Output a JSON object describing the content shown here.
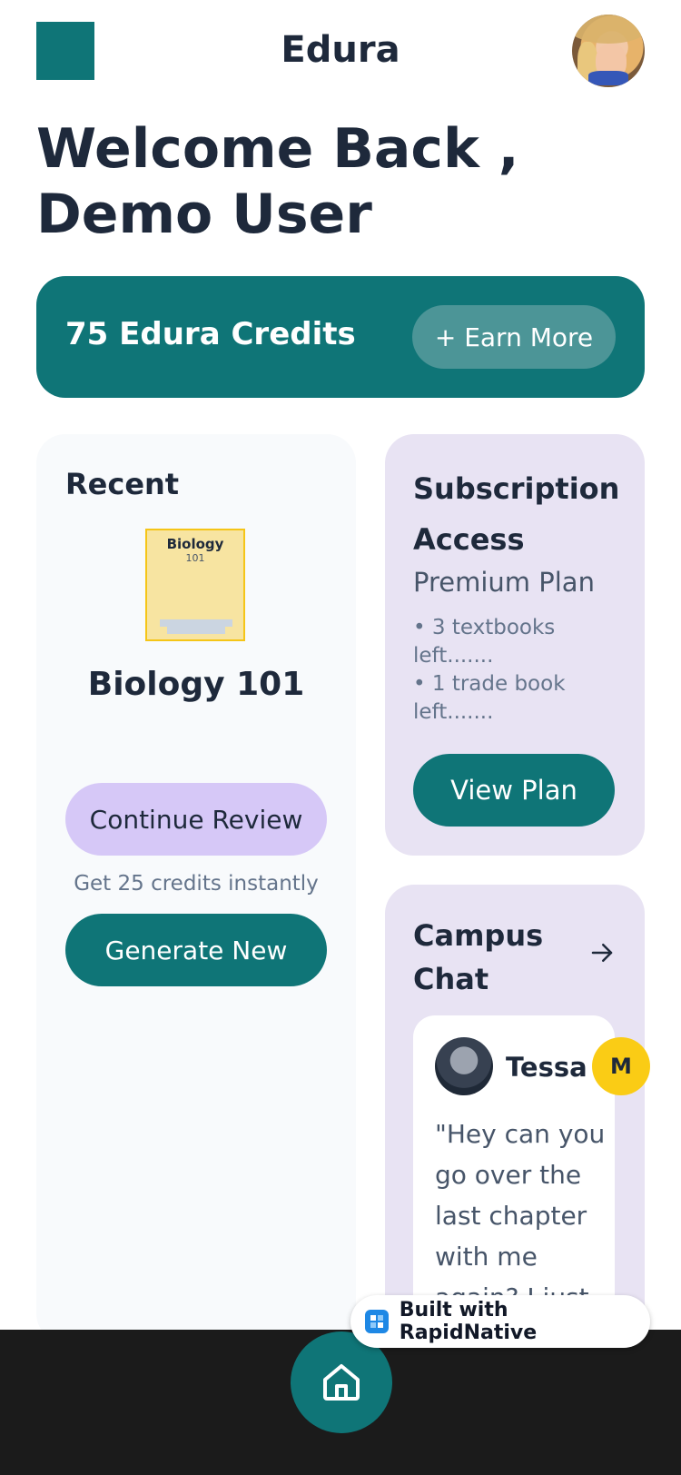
{
  "header": {
    "app_title": "Edura"
  },
  "welcome": {
    "text": "Welcome Back , Demo User"
  },
  "credits": {
    "label": "75 Edura Credits",
    "earn_button": "+ Earn More"
  },
  "recent": {
    "heading": "Recent",
    "book_cover_title": "Biology",
    "book_cover_subtitle": "101",
    "title": "Biology 101",
    "continue_button": "Continue Review",
    "credits_note": "Get 25 credits instantly",
    "generate_button": "Generate New"
  },
  "subscription": {
    "heading": "Subscription Access",
    "plan": "Premium Plan",
    "items": [
      "• 3 textbooks left.......",
      "• 1 trade book left......."
    ],
    "view_button": "View Plan"
  },
  "chat": {
    "heading": "Campus Chat",
    "message": {
      "name": "Tessa",
      "text": "\"Hey can you go over the last chapter with me again? I just"
    },
    "badge": "M"
  },
  "footer": {
    "built_with": "Built with RapidNative"
  },
  "colors": {
    "accent": "#0f7577",
    "lavender": "#e8e3f3",
    "badge_yellow": "#facc15"
  }
}
